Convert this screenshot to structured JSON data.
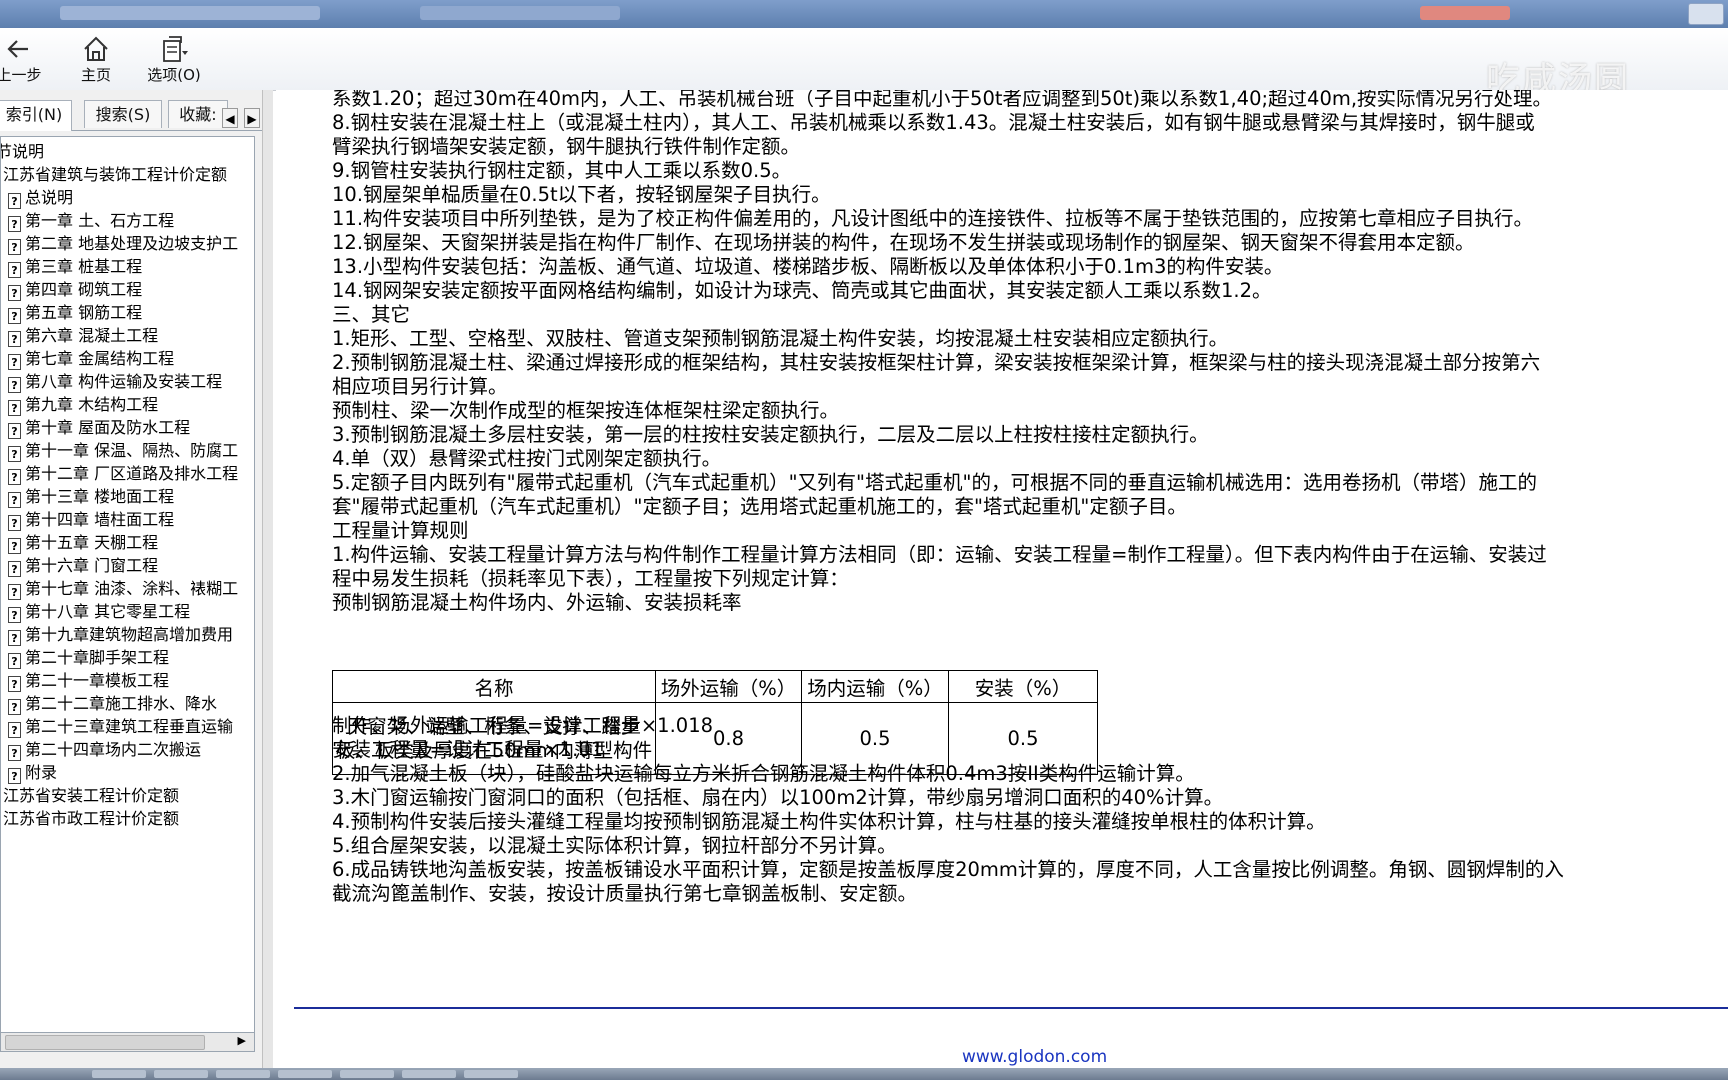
{
  "toolbar": {
    "back_label": "上一步",
    "home_label": "主页",
    "options_label": "选项(O)"
  },
  "watermark": "吃咸汤圆",
  "tabs": {
    "index": "索引(N)",
    "search": "搜索(S)",
    "favorites": "收藏:"
  },
  "tree": {
    "rows": [
      "节说明",
      "江苏省建筑与装饰工程计价定额",
      "总说明",
      "第一章 土、石方工程",
      "第二章 地基处理及边坡支护工",
      "第三章 桩基工程",
      "第四章 砌筑工程",
      "第五章 钢筋工程",
      "第六章 混凝土工程",
      "第七章 金属结构工程",
      "第八章 构件运输及安装工程",
      "第九章 木结构工程",
      "第十章 屋面及防水工程",
      "第十一章 保温、隔热、防腐工",
      "第十二章 厂区道路及排水工程",
      "第十三章 楼地面工程",
      "第十四章 墙柱面工程",
      "第十五章 天棚工程",
      "第十六章 门窗工程",
      "第十七章 油漆、涂料、裱糊工",
      "第十八章 其它零星工程",
      "第十九章建筑物超高增加费用",
      "第二十章脚手架工程",
      "第二十一章模板工程",
      "第二十二章施工排水、降水",
      "第二十三章建筑工程垂直运输",
      "第二十四章场内二次搬运",
      "附录",
      "江苏省安装工程计价定额",
      "江苏省市政工程计价定额"
    ]
  },
  "content": {
    "lines_top": [
      "系数1.20；超过30m在40m内，人工、吊装机械台班（子目中起重机小于50t者应调整到50t)乘以系数1,40;超过40m,按实际情况另行处理。",
      "8.钢柱安装在混凝土柱上（或混凝土柱内），其人工、吊装机械乘以系数1.43。混凝土柱安装后，如有钢牛腿或悬臂梁与其焊接时，钢牛腿或",
      "臂梁执行钢墙架安装定额，钢牛腿执行铁件制作定额。",
      "9.钢管柱安装执行钢柱定额，其中人工乘以系数0.5。",
      "10.钢屋架单榀质量在0.5t以下者，按轻钢屋架子目执行。",
      "11.构件安装项目中所列垫铁，是为了校正构件偏差用的，凡设计图纸中的连接铁件、拉板等不属于垫铁范围的，应按第七章相应子目执行。",
      "12.钢屋架、天窗架拼装是指在构件厂制作、在现场拼装的构件，在现场不发生拼装或现场制作的钢屋架、钢天窗架不得套用本定额。",
      "13.小型构件安装包括：沟盖板、通气道、垃圾道、楼梯踏步板、隔断板以及单体体积小于0.1m3的构件安装。",
      "14.钢网架安装定额按平面网格结构编制，如设计为球壳、筒壳或其它曲面状，其安装定额人工乘以系数1.2。",
      "三、其它",
      "1.矩形、工型、空格型、双肢柱、管道支架预制钢筋混凝土构件安装，均按混凝土柱安装相应定额执行。",
      "2.预制钢筋混凝土柱、梁通过焊接形成的框架结构，其柱安装按框架柱计算，梁安装按框架梁计算，框架梁与柱的接头现浇混凝土部分按第六",
      "相应项目另行计算。",
      "预制柱、梁一次制作成型的框架按连体框架柱梁定额执行。",
      "3.预制钢筋混凝土多层柱安装，第一层的柱按柱安装定额执行，二层及二层以上柱按柱接柱定额执行。",
      "4.单（双）悬臂梁式柱按门式刚架定额执行。",
      "5.定额子目内既列有\"履带式起重机（汽车式起重机）\"又列有\"塔式起重机\"的，可根据不同的垂直运输机械选用：选用卷扬机（带塔）施工的",
      "套\"履带式起重机（汽车式起重机）\"定额子目；选用塔式起重机施工的，套\"塔式起重机\"定额子目。",
      "工程量计算规则",
      "1.构件运输、安装工程量计算方法与构件制作工程量计算方法相同（即：运输、安装工程量=制作工程量）。但下表内构件由于在运输、安装过",
      "程中易发生损耗（损耗率见下表），工程量按下列规定计算：",
      "预制钢筋混凝土构件场内、外运输、安装损耗率"
    ],
    "table": {
      "headers": [
        "名称",
        "场外运输（%）",
        "场内运输（%）",
        "安装（%）"
      ],
      "row_name_1": "天窗架、端壁、桁条、支撑、踏步",
      "row_name_2": "板、板类及厚度在50mm内薄型构件",
      "row_values": [
        "0.8",
        "0.5",
        "0.5"
      ]
    },
    "lines_bottom": [
      "制作、场外运输工程量=设计工程量×1.018",
      "安装工程量=设计工程量×1.01",
      "2.加气混凝土板（块），硅酸盐块运输每立方米折合钢筋混凝土构件体积0.4m3按II类构件运输计算。",
      "3.木门窗运输按门窗洞口的面积（包括框、扇在内）以100m2计算，带纱扇另增洞口面积的40%计算。",
      "4.预制构件安装后接头灌缝工程量均按预制钢筋混凝土构件实体积计算，柱与柱基的接头灌缝按单根柱的体积计算。",
      "5.组合屋架安装，以混凝土实际体积计算，钢拉杆部分不另计算。",
      "6.成品铸铁地沟盖板安装，按盖板铺设水平面积计算，定额是按盖板厚度20mm计算的，厚度不同，人工含量按比例调整。角钢、圆钢焊制的入",
      "截流沟篦盖制作、安装，按设计质量执行第七章钢盖板制、安定额。"
    ],
    "footer_link": "www.glodon.com"
  }
}
